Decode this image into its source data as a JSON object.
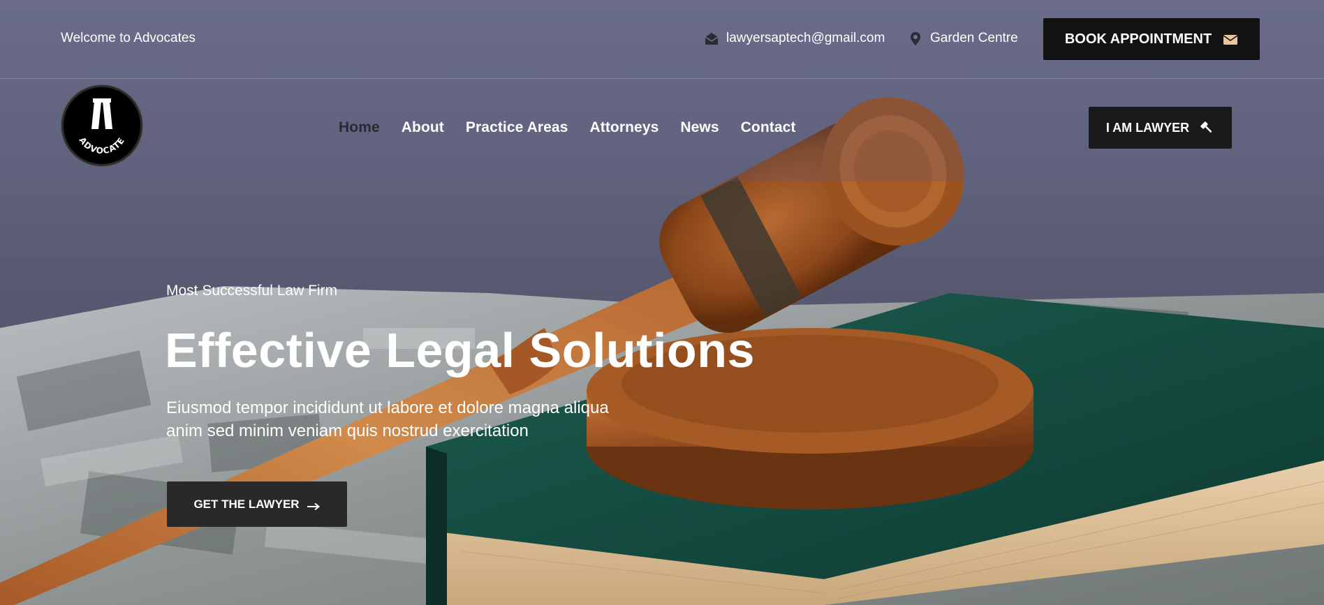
{
  "topbar": {
    "welcome": "Welcome to Advocates",
    "email": "lawyersaptech@gmail.com",
    "location": "Garden Centre",
    "book_label": "BOOK APPOINTMENT"
  },
  "logo": {
    "text": "ADVOCATE"
  },
  "nav": {
    "items": [
      {
        "label": "Home"
      },
      {
        "label": "About"
      },
      {
        "label": "Practice Areas"
      },
      {
        "label": "Attorneys"
      },
      {
        "label": "News"
      },
      {
        "label": "Contact"
      }
    ],
    "lawyer_label": "I AM LAWYER"
  },
  "hero": {
    "eyebrow": "Most Successful Law Firm",
    "title": "Effective Legal Solutions",
    "line1": "Eiusmod tempor incididunt ut labore et dolore magna aliqua",
    "line2": "anim sed minim veniam quis nostrud exercitation",
    "cta_label": "GET THE LAWYER"
  },
  "colors": {
    "dark_button": "#121212",
    "nav_active": "#2a2a33",
    "accent_icon": "#e8c79a"
  },
  "icons": [
    "envelope-open-icon",
    "map-pin-icon",
    "envelope-icon",
    "gavel-icon",
    "arrow-right-icon"
  ]
}
